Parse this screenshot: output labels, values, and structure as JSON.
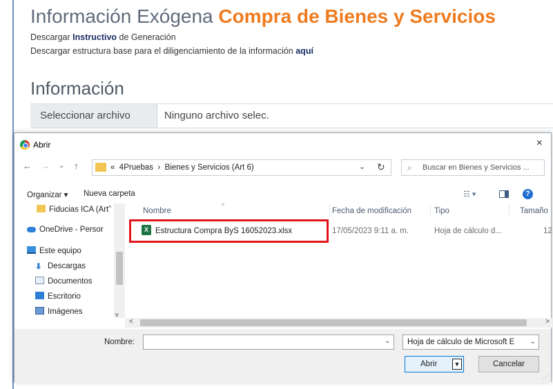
{
  "page": {
    "title_plain": "Información Exógena ",
    "title_accent": "Compra de Bienes y Servicios",
    "line1_prefix": "Descargar ",
    "line1_link": "Instructivo",
    "line1_suffix": " de Generación",
    "line2_prefix": "Descargar estructura base para el diligenciamiento de la información ",
    "line2_link": "aquí",
    "section_title": "Información",
    "file_button": "Seleccionar archivo",
    "file_status": "Ninguno archivo selec."
  },
  "dialog": {
    "title": "Abrir",
    "close": "×",
    "nav": {
      "back": "←",
      "forward": "→",
      "recent": "⌄",
      "up": "↑"
    },
    "address": {
      "prefix": "«",
      "crumb1": "4Pruebas",
      "sep": "›",
      "crumb2": "Bienes y Servicios (Art 6)",
      "dropdown": "⌄",
      "refresh": "↻"
    },
    "search_placeholder": "Buscar en Bienes y Servicios ...",
    "search_icon": "⌕",
    "toolbar": {
      "organize": "Organizar ▾",
      "new_folder": "Nueva carpeta",
      "view_icon": "☷ ▾",
      "help": "?"
    },
    "nav_pane": [
      {
        "label": "Fiducias ICA (Art",
        "icon": "folder-icon"
      },
      {
        "label": "OneDrive - Persor",
        "icon": "onedrive-icon"
      },
      {
        "label": "Este equipo",
        "icon": "pc-icon"
      },
      {
        "label": "Descargas",
        "icon": "download-icon"
      },
      {
        "label": "Documentos",
        "icon": "documents-icon"
      },
      {
        "label": "Escritorio",
        "icon": "desktop-icon"
      },
      {
        "label": "Imágenes",
        "icon": "images-icon"
      }
    ],
    "nav_pane_up": "^",
    "nav_pane_down": "v",
    "columns": {
      "name": "Nombre",
      "modified": "Fecha de modificación",
      "type": "Tipo",
      "size": "Tamaño",
      "sort": "^"
    },
    "files": [
      {
        "name": "Estructura Compra ByS 16052023.xlsx",
        "modified": "17/05/2023 9:11 a. m.",
        "type": "Hoja de cálculo d...",
        "size": "12",
        "icon": "excel-icon"
      }
    ],
    "hscroll": {
      "left": "<",
      "right": ">"
    },
    "footer": {
      "name_label": "Nombre:",
      "name_value": "",
      "name_dropdown": "⌄",
      "file_type": "Hoja de cálculo de Microsoft E",
      "file_type_chevron": "⌄",
      "open": "Abrir",
      "open_split": "▼",
      "cancel": "Cancelar"
    }
  },
  "colors": {
    "accent_orange": "#ee7b1f",
    "link_navy": "#1b2f66",
    "highlight_red": "#e1141b",
    "excel_green": "#1f7244",
    "primary_blue": "#0078d7"
  }
}
